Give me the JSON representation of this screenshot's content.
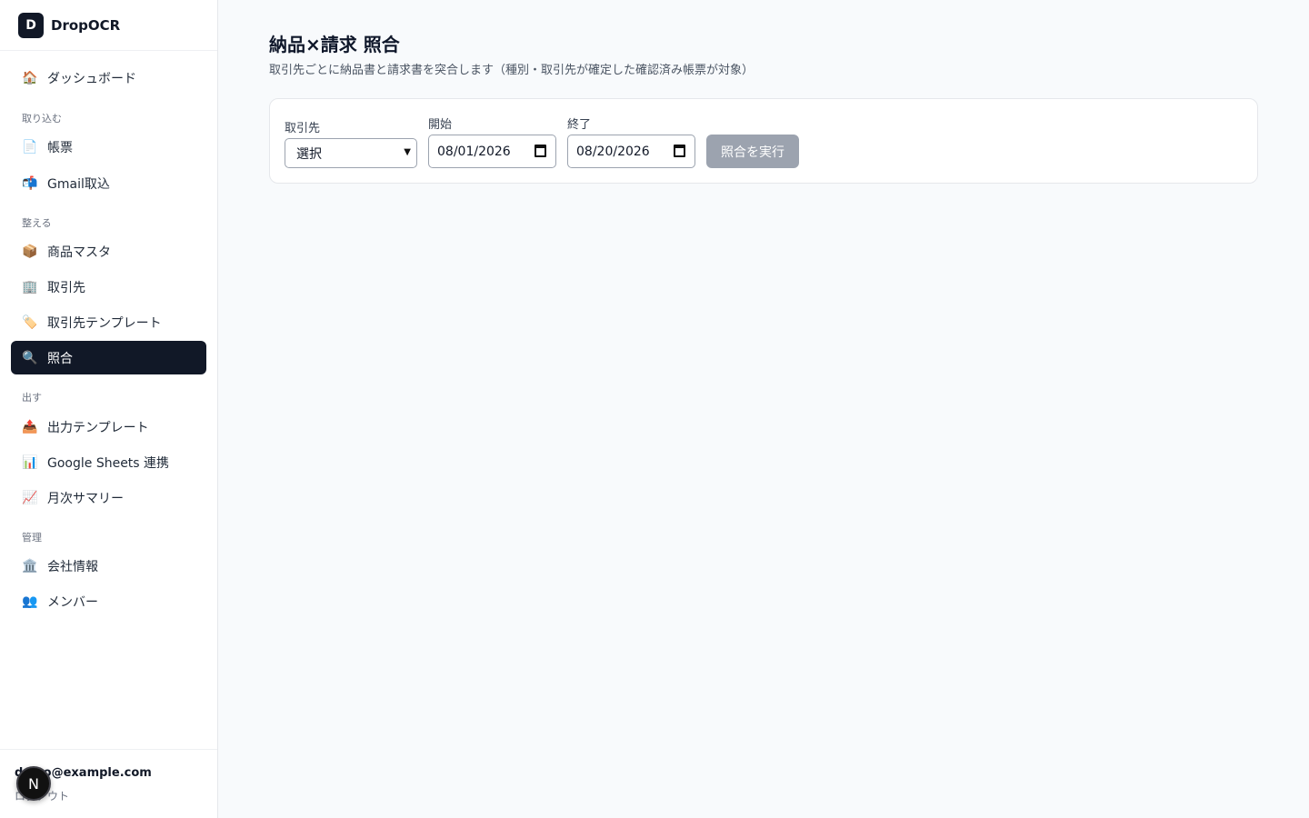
{
  "app": {
    "logo_letter": "D",
    "name": "DropOCR"
  },
  "nav": {
    "top": [
      {
        "icon": "house-icon",
        "glyph": "🏠",
        "label": "ダッシュボード"
      }
    ],
    "sections": [
      {
        "label": "取り込む",
        "items": [
          {
            "icon": "document-icon",
            "glyph": "📄",
            "label": "帳票"
          },
          {
            "icon": "mailbox-icon",
            "glyph": "📬",
            "label": "Gmail取込"
          }
        ]
      },
      {
        "label": "整える",
        "items": [
          {
            "icon": "package-icon",
            "glyph": "📦",
            "label": "商品マスタ"
          },
          {
            "icon": "building-icon",
            "glyph": "🏢",
            "label": "取引先"
          },
          {
            "icon": "tag-icon",
            "glyph": "🏷️",
            "label": "取引先テンプレート"
          },
          {
            "icon": "magnifier-icon",
            "glyph": "🔍",
            "label": "照合",
            "active": true
          }
        ]
      },
      {
        "label": "出す",
        "items": [
          {
            "icon": "outbox-icon",
            "glyph": "📤",
            "label": "出力テンプレート"
          },
          {
            "icon": "bar-chart-icon",
            "glyph": "📊",
            "label": "Google Sheets 連携"
          },
          {
            "icon": "line-chart-icon",
            "glyph": "📈",
            "label": "月次サマリー"
          }
        ]
      },
      {
        "label": "管理",
        "items": [
          {
            "icon": "bank-icon",
            "glyph": "🏛️",
            "label": "会社情報"
          },
          {
            "icon": "people-icon",
            "glyph": "👥",
            "label": "メンバー"
          }
        ]
      }
    ]
  },
  "footer": {
    "email": "demo@example.com",
    "logout": "ログアウト",
    "badge": "N"
  },
  "page": {
    "title": "納品×請求 照合",
    "subtitle": "取引先ごとに納品書と請求書を突合します（種別・取引先が確定した確認済み帳票が対象）"
  },
  "form": {
    "partner_label": "取引先",
    "partner_value": "選択",
    "start_label": "開始",
    "start_value": "08/01/2026",
    "end_label": "終了",
    "end_value": "08/20/2026",
    "run_label": "照合を実行"
  },
  "colors": {
    "active_nav": "#111827",
    "disabled_button": "#9ca3af"
  }
}
